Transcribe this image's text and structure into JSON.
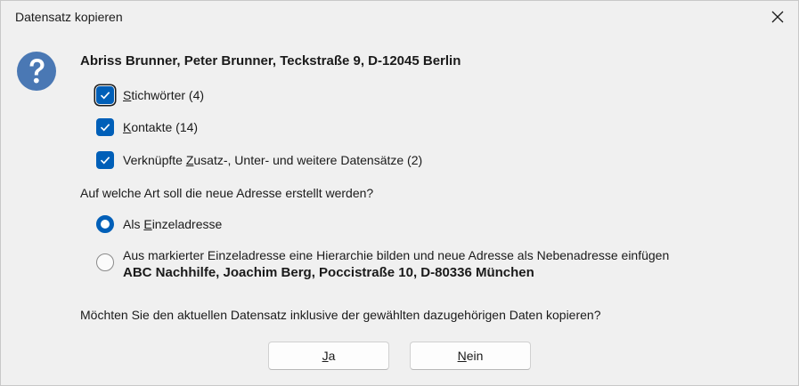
{
  "window": {
    "title": "Datensatz kopieren"
  },
  "icons": {
    "main": "question-icon",
    "close": "close-icon",
    "check": "checkmark-icon"
  },
  "colors": {
    "accent": "#005fb8",
    "question_icon": "#4a78b4",
    "background": "#f0f0f0"
  },
  "record": {
    "title": "Abriss Brunner, Peter Brunner, Teckstraße 9, D-12045 Berlin"
  },
  "checkboxes": [
    {
      "pre": "",
      "key": "S",
      "post": "tichwörter (4)",
      "checked": true
    },
    {
      "pre": "",
      "key": "K",
      "post": "ontakte (14)",
      "checked": true
    },
    {
      "pre": "Verknüpfte ",
      "key": "Z",
      "post": "usatz-, Unter- und  weitere Datensätze (2)",
      "checked": true
    }
  ],
  "question": "Auf welche Art soll die neue Adresse erstellt werden?",
  "radios": [
    {
      "pre": "Als ",
      "key": "E",
      "post": "inzeladresse",
      "selected": true
    },
    {
      "text": "Aus markierter Einzeladresse eine Hierarchie bilden und neue Adresse als Nebenadresse einfügen",
      "subtext": "ABC Nachhilfe, Joachim Berg, Poccistraße 10, D-80336 München",
      "selected": false
    }
  ],
  "confirm": "Möchten Sie den aktuellen Datensatz inklusive der gewählten dazugehörigen Daten kopieren?",
  "buttons": {
    "yes": {
      "key": "J",
      "post": "a"
    },
    "no": {
      "key": "N",
      "post": "ein"
    }
  }
}
